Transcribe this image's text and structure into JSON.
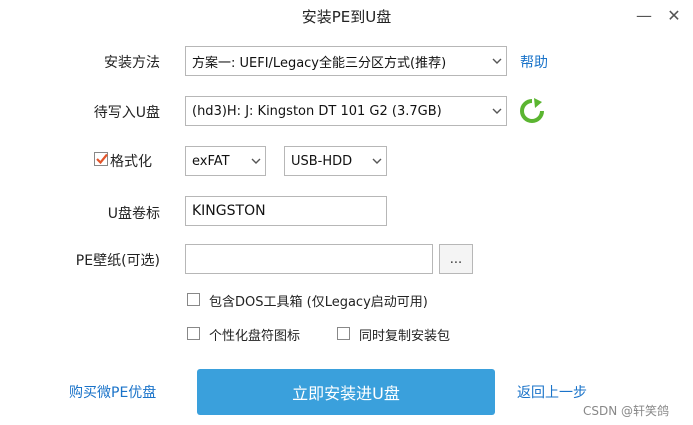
{
  "window": {
    "title": "安装PE到U盘",
    "minimize_glyph": "—",
    "close_glyph": "✕"
  },
  "form": {
    "install_method": {
      "label": "安装方法",
      "value": "方案一: UEFI/Legacy全能三分区方式(推荐)",
      "help_link": "帮助"
    },
    "target_drive": {
      "label": "待写入U盘",
      "value": "(hd3)H: J: Kingston DT 101 G2 (3.7GB)",
      "refresh_icon": "refresh-icon"
    },
    "format": {
      "label": "格式化",
      "checked": true,
      "filesystem": "exFAT",
      "mode": "USB-HDD"
    },
    "volume_label": {
      "label": "U盘卷标",
      "value": "KINGSTON"
    },
    "wallpaper": {
      "label": "PE壁纸(可选)",
      "value": "",
      "browse_label": "..."
    },
    "options": {
      "include_dos": "包含DOS工具箱 (仅Legacy启动可用)",
      "personalize_icon": "个性化盘符图标",
      "copy_installer": "同时复制安装包"
    }
  },
  "footer": {
    "buy_link": "购买微PE优盘",
    "install_button": "立即安装进U盘",
    "back_link": "返回上一步"
  },
  "watermark": "CSDN @轩笑鸽",
  "colors": {
    "accent": "#3aa0dc",
    "link": "#1a73c9",
    "check": "#e2552b",
    "refresh": "#5bb531"
  }
}
